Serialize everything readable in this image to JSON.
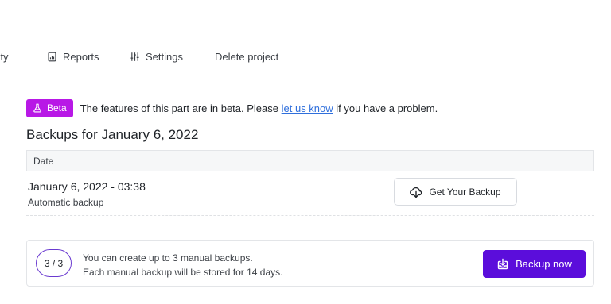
{
  "tabs": {
    "security_partial": "urity",
    "reports": "Reports",
    "settings": "Settings",
    "delete": "Delete project"
  },
  "beta": {
    "badge": "Beta",
    "text_before": "The features of this part are in beta. Please",
    "link": "let us know",
    "text_after": "if you have a problem."
  },
  "backups": {
    "title": "Backups for January 6, 2022",
    "column_date": "Date",
    "rows": [
      {
        "date": "January 6, 2022 - 03:38",
        "type": "Automatic backup",
        "action": "Get Your Backup"
      }
    ]
  },
  "manual": {
    "counter": "3 / 3",
    "line1": "You can create up to 3 manual backups.",
    "line2": "Each manual backup will be stored for 14 days.",
    "button": "Backup now"
  },
  "colors": {
    "beta_badge": "#b818e6",
    "primary_button": "#5b0ddb",
    "link": "#2f6fdc"
  },
  "icons": [
    "reports-icon",
    "settings-sliders-icon",
    "flask-icon",
    "cloud-download-icon",
    "backup-tray-icon"
  ]
}
